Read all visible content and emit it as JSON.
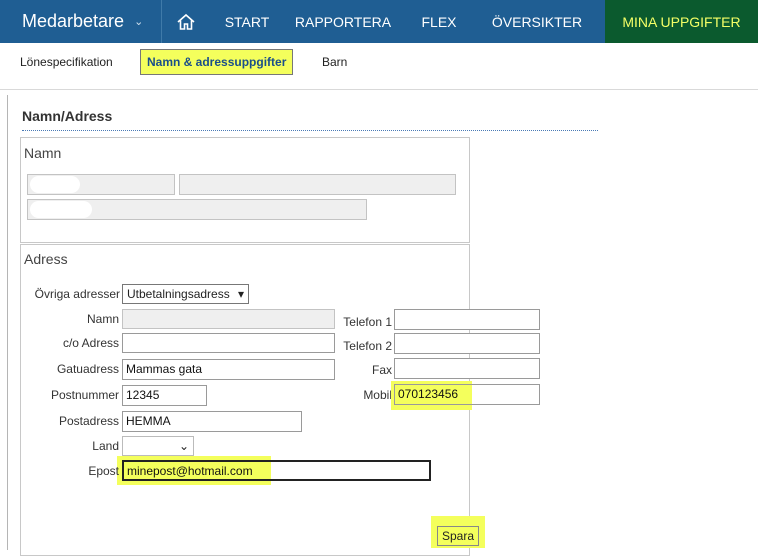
{
  "topbar": {
    "app_title": "Medarbetare",
    "app_chevron": "⌄",
    "home_icon": "home-icon",
    "nav": [
      "START",
      "RAPPORTERA",
      "FLEX",
      "ÖVERSIKTER",
      "MINA UPPGIFTER"
    ],
    "active_nav": "MINA UPPGIFTER",
    "colors": {
      "bar": "#1f5e93",
      "active_bg": "#0b5a2e",
      "active_text": "#f4ff66"
    }
  },
  "subnav": {
    "tabs": [
      "Lönespecifikation",
      "Namn & adressuppgifter",
      "Barn"
    ],
    "selected": "Namn & adressuppgifter"
  },
  "page": {
    "title": "Namn/Adress",
    "name_section": {
      "legend": "Namn"
    },
    "address_section": {
      "legend": "Adress",
      "other_addresses_label": "Övriga adresser",
      "other_addresses_value": "Utbetalningsadress",
      "labels": {
        "name": "Namn",
        "co": "c/o Adress",
        "street": "Gatuadress",
        "zip": "Postnummer",
        "city": "Postadress",
        "country": "Land",
        "email": "Epost",
        "phone1": "Telefon 1",
        "phone2": "Telefon 2",
        "fax": "Fax",
        "mobile": "Mobil"
      },
      "values": {
        "name": "",
        "co": "",
        "street": "Mammas gata",
        "zip": "12345",
        "city": "HEMMA",
        "country": "",
        "email": "minepost@hotmail.com",
        "phone1": "",
        "phone2": "",
        "fax": "",
        "mobile": "070123456"
      },
      "save_label": "Spara",
      "highlight_color": "#f4ff5c"
    }
  }
}
